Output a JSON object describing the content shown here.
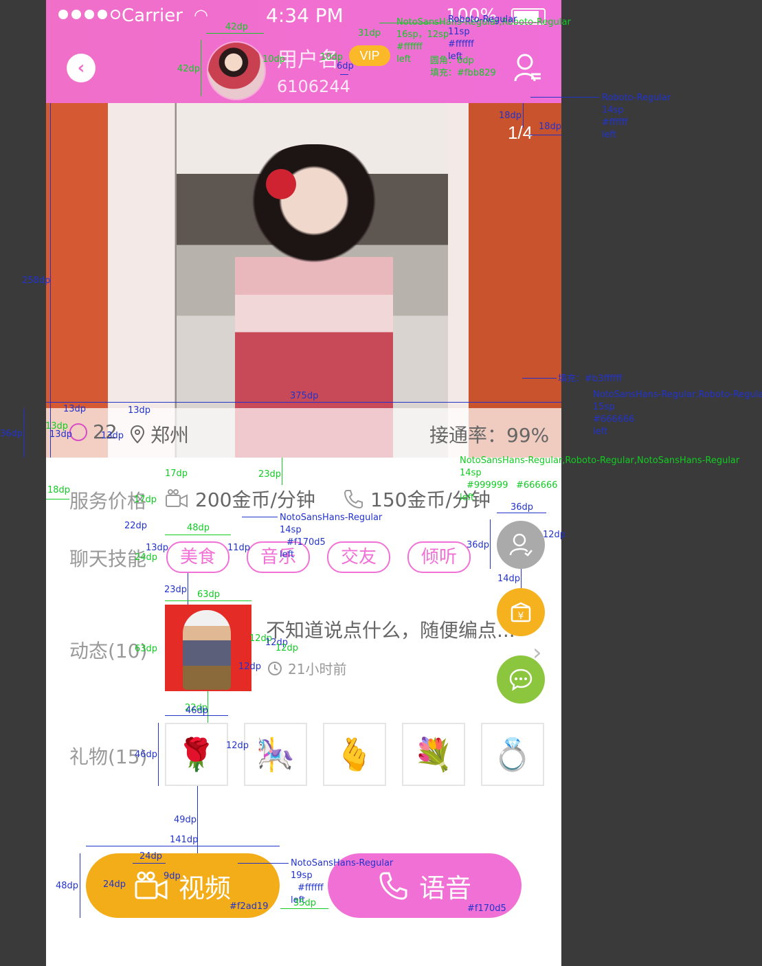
{
  "status_bar": {
    "carrier": "Carrier",
    "time": "4:34 PM",
    "battery": "100%"
  },
  "header": {
    "username": "用户名",
    "user_id": "6106244",
    "vip": "VIP"
  },
  "photo": {
    "counter": "1/4"
  },
  "profile": {
    "age": "22",
    "city": "郑州",
    "connect_rate": "接通率：99%"
  },
  "service": {
    "label": "服务价格",
    "video_price": "200金币/分钟",
    "voice_price": "150金币/分钟"
  },
  "skills": {
    "label": "聊天技能",
    "tags": [
      "美食",
      "音乐",
      "交友",
      "倾听"
    ]
  },
  "moments": {
    "label": "动态(10)",
    "text": "不知道说点什么，随便编点...",
    "time": "21小时前"
  },
  "gifts": {
    "label": "礼物(15)",
    "items": [
      "🌹",
      "🎠",
      "🫰",
      "💐",
      "💍"
    ]
  },
  "actions": {
    "video": "视频",
    "voice": "语音",
    "video_color": "#f2ad19",
    "voice_color": "#f170d5"
  },
  "colors": {
    "accent": "#f170d5",
    "vip": "#fbb829",
    "text_main": "#666666",
    "text_sub": "#999999"
  },
  "annotations": {
    "a1": "42dp",
    "a2": "42dp",
    "a3": "10dp",
    "a4": "31dp",
    "a5": "10dp",
    "a6": "6dp",
    "a7": "NotoSansHans-Regular,Roboto-Regular",
    "a8": "16sp，12sp",
    "a9": "#ffffff",
    "a10": "left",
    "a11": "Roboto-Regular",
    "a12": "11sp",
    "a13": "#ffffff",
    "a14": "left",
    "a15": "圆角：6dp",
    "a16": "填充：#fbb829",
    "a17": "Roboto-Regular",
    "a18": "14sp",
    "a19": "#ffffff",
    "a20": "left",
    "a21": "18dp",
    "a22": "18dp",
    "a23": "258dp",
    "a24": "375dp",
    "a25": "填充：#b3ffffff",
    "a26": "NotoSansHans-Regular,Roboto-Regular",
    "a27": "15sp",
    "a28": "#666666",
    "a29": "left",
    "a30": "36dp",
    "a31": "13dp",
    "a32": "13dp",
    "a33": "13dp",
    "a34": "13dp",
    "a35": "13dp",
    "a36": "23dp",
    "a37": "NotoSansHans-Regular,Roboto-Regular,NotoSansHans-Regular",
    "a38": "14sp",
    "a39": "#999999",
    "a40": "#666666",
    "a41": "left",
    "a42": "18dp",
    "a43": "17dp",
    "a44": "17dp",
    "a45": "22dp",
    "a46": "48dp",
    "a47": "13dp",
    "a48": "24dp",
    "a49": "11dp",
    "a50": "NotoSansHans-Regular",
    "a51": "14sp",
    "a52": "#f170d5",
    "a53": "left",
    "a54": "36dp",
    "a55": "36dp",
    "a56": "12dp",
    "a57": "14dp",
    "a58": "23dp",
    "a59": "63dp",
    "a60": "63dp",
    "a61": "12dp",
    "a62": "12dp",
    "a63": "12dp",
    "a64": "12dp",
    "a65": "22dp",
    "a66": "46dp",
    "a67": "46dp",
    "a68": "12dp",
    "a69": "49dp",
    "a70": "141dp",
    "a71": "24dp",
    "a72": "24dp",
    "a73": "9dp",
    "a74": "48dp",
    "a75": "NotoSansHans-Regular",
    "a76": "19sp",
    "a77": "#ffffff",
    "a78": "left",
    "a79": "35dp",
    "a80": "#f2ad19",
    "a81": "#f170d5"
  }
}
